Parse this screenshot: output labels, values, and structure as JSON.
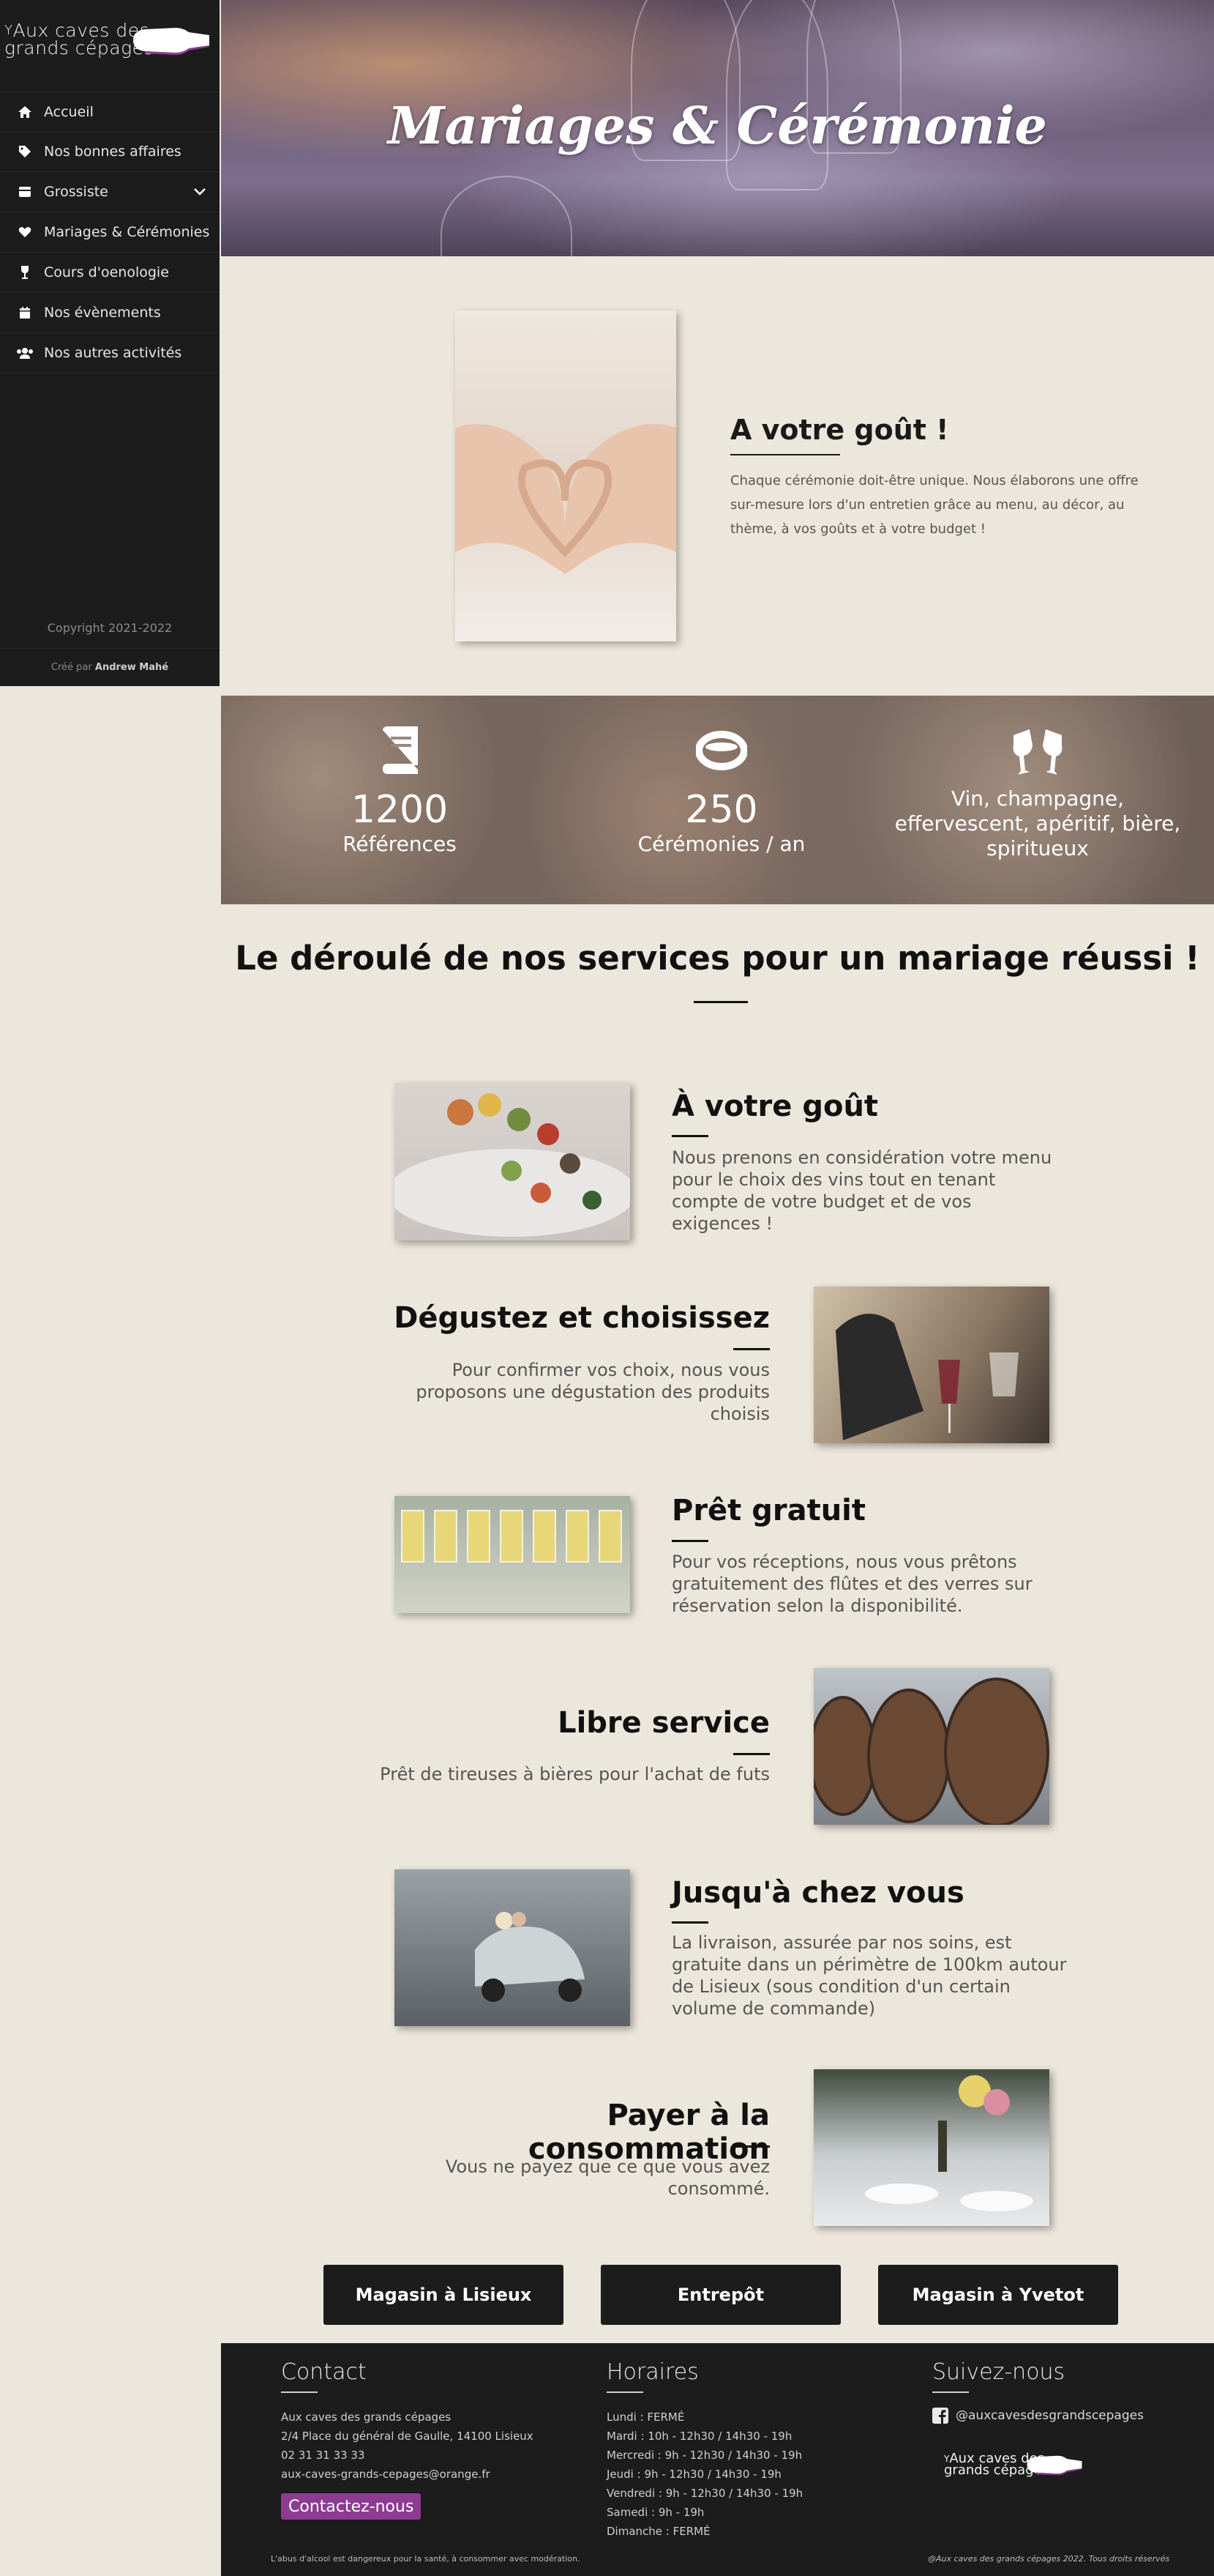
{
  "brand": {
    "line1": "Aux caves des",
    "line2": "grands cépages"
  },
  "sidebar": {
    "items": [
      {
        "label": "Accueil",
        "icon": "home-icon"
      },
      {
        "label": "Nos bonnes affaires",
        "icon": "tag-icon"
      },
      {
        "label": "Grossiste",
        "icon": "store-icon",
        "expandable": true
      },
      {
        "label": "Mariages & Cérémonies",
        "icon": "heart-icon"
      },
      {
        "label": "Cours d'oenologie",
        "icon": "wine-glass-icon"
      },
      {
        "label": "Nos évènements",
        "icon": "calendar-icon"
      },
      {
        "label": "Nos autres activités",
        "icon": "users-icon"
      }
    ],
    "copyright": "Copyright 2021-2022",
    "created_prefix": "Créé par",
    "created_by": "Andrew Mahé"
  },
  "hero": {
    "title": "Mariages & Cérémonie"
  },
  "intro": {
    "title": "A votre goût !",
    "text": "Chaque cérémonie doit-être unique. Nous élaborons une offre sur-mesure lors d'un entretien grâce au menu, au décor, au thème, à vos goûts et à votre budget !"
  },
  "stats": [
    {
      "icon": "book-icon",
      "number": "1200",
      "label": "Références"
    },
    {
      "icon": "ring-icon",
      "number": "250",
      "label": "Cérémonies / an"
    },
    {
      "icon": "glasses-cheers-icon",
      "number": "",
      "label": "Vin, champagne, effervescent, apéritif, bière, spiritueux"
    }
  ],
  "services_title": "Le déroulé de nos services pour un mariage réussi !",
  "services": [
    {
      "title": "À votre goût",
      "text": "Nous prenons en considération votre menu pour le choix des vins tout en tenant compte de votre budget et de vos exigences !"
    },
    {
      "title": "Dégustez et choisissez",
      "text": "Pour confirmer vos choix, nous vous proposons une dégustation des produits choisis"
    },
    {
      "title": "Prêt gratuit",
      "text": "Pour vos réceptions, nous vous prêtons gratuitement des flûtes et des verres sur réservation selon la disponibilité."
    },
    {
      "title": "Libre service",
      "text": "Prêt de tireuses à bières pour l'achat de futs"
    },
    {
      "title": "Jusqu'à chez vous",
      "text": "La livraison, assurée par nos soins, est gratuite dans un périmètre de 100km autour de Lisieux (sous condition d'un certain volume de commande)"
    },
    {
      "title": "Payer à la consommation",
      "text": "Vous ne payez que ce que vous avez consommé."
    }
  ],
  "buttons": [
    "Magasin à Lisieux",
    "Entrepôt",
    "Magasin à Yvetot"
  ],
  "footer": {
    "contact_title": "Contact",
    "contact_lines": [
      "Aux caves des grands cépages",
      "2/4 Place du général de Gaulle, 14100 Lisieux",
      "02 31 31 33 33",
      "aux-caves-grands-cepages@orange.fr"
    ],
    "contact_button": "Contactez-nous",
    "hours_title": "Horaires",
    "hours": [
      "Lundi : FERMÉ",
      "Mardi : 10h - 12h30 / 14h30 - 19h",
      "Mercredi : 9h - 12h30 / 14h30 - 19h",
      "Jeudi : 9h - 12h30 / 14h30 - 19h",
      "Vendredi : 9h - 12h30 / 14h30 - 19h",
      "Samedi : 9h - 19h",
      "Dimanche : FERMÉ"
    ],
    "follow_title": "Suivez-nous",
    "social_handle": "@auxcavesdesgrandscepages",
    "disclaimer": "L'abus d'alcool est dangereux pour la santé, à consommer avec modération.",
    "rights": "@Aux caves des grands cépages 2022. Tous droits réservés"
  },
  "colors": {
    "accent": "#8e3b92",
    "dark": "#1c1c1c",
    "background": "#ece7dc"
  }
}
